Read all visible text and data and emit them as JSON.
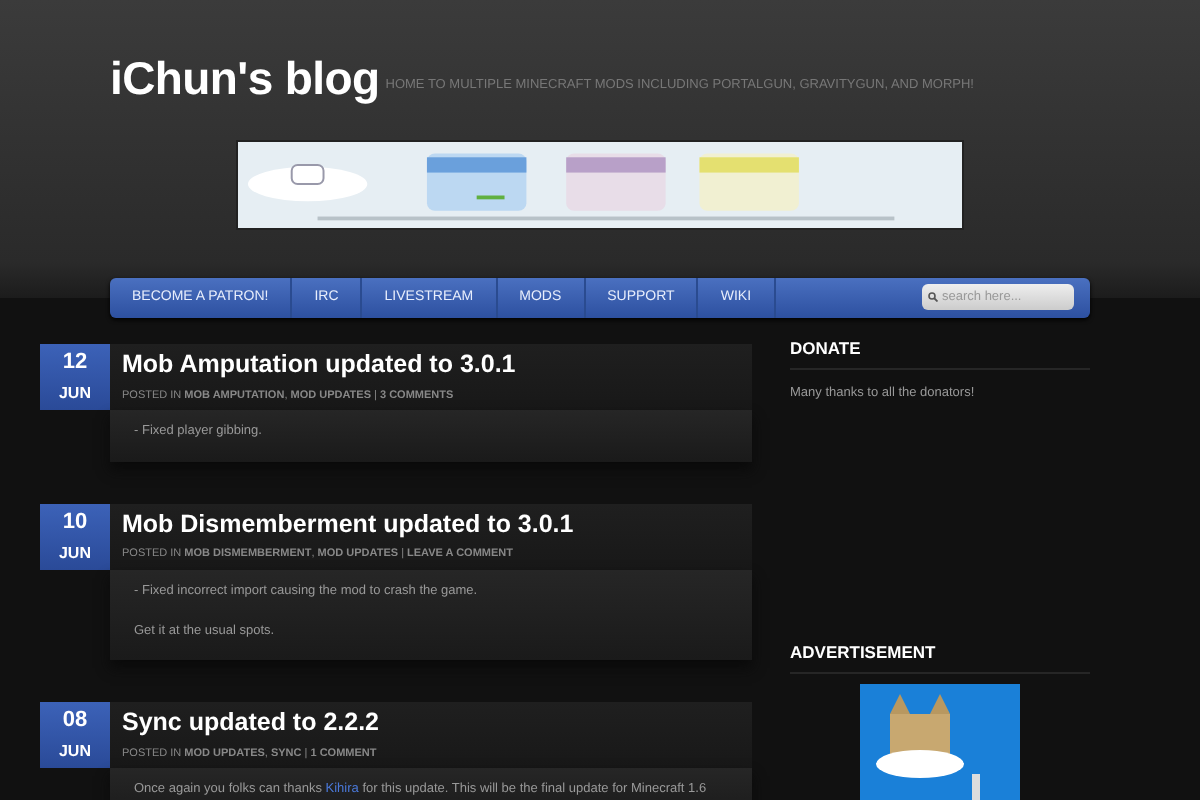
{
  "site": {
    "title": "iChun's blog",
    "tagline": "HOME TO MULTIPLE MINECRAFT MODS INCLUDING PORTALGUN, GRAVITYGUN, AND MORPH!"
  },
  "nav": {
    "items": [
      {
        "label": "BECOME A PATRON!"
      },
      {
        "label": "IRC"
      },
      {
        "label": "LIVESTREAM"
      },
      {
        "label": "MODS"
      },
      {
        "label": "SUPPORT"
      },
      {
        "label": "WIKI"
      }
    ],
    "search": {
      "placeholder": "search here..."
    }
  },
  "posts": [
    {
      "day": "12",
      "month": "JUN",
      "title": "Mob Amputation updated to 3.0.1",
      "posted_in": "POSTED IN",
      "categories": [
        "MOB AMPUTATION",
        "MOD UPDATES"
      ],
      "comments": "3 COMMENTS",
      "separators": [
        ",",
        "|"
      ],
      "body": [
        [
          {
            "kind": "text",
            "text": "- Fixed player gibbing."
          }
        ]
      ]
    },
    {
      "day": "10",
      "month": "JUN",
      "title": "Mob Dismemberment updated to 3.0.1",
      "posted_in": "POSTED IN",
      "categories": [
        "MOB DISMEMBERMENT",
        "MOD UPDATES"
      ],
      "comments": "LEAVE A COMMENT",
      "separators": [
        ",",
        "|"
      ],
      "body": [
        [
          {
            "kind": "text",
            "text": "- Fixed incorrect import causing the mod to crash the game."
          }
        ],
        [
          {
            "kind": "text",
            "text": "Get it at the usual spots."
          }
        ]
      ]
    },
    {
      "day": "08",
      "month": "JUN",
      "title": "Sync updated to 2.2.2",
      "posted_in": "POSTED IN",
      "categories": [
        "MOD UPDATES",
        "SYNC"
      ],
      "comments": "1 COMMENT",
      "separators": [
        ",",
        "|"
      ],
      "body": [
        [
          {
            "kind": "text",
            "text": "Once again you folks can thanks "
          },
          {
            "kind": "link",
            "text": "Kihira"
          },
          {
            "kind": "text",
            "text": " for this update. This will be the final update for Minecraft 1.6"
          }
        ]
      ]
    }
  ],
  "sidebar": [
    {
      "kind": "text",
      "heading": "DONATE",
      "text": "Many thanks to all the donators!"
    },
    {
      "kind": "picture",
      "heading": "ADVERTISEMENT"
    }
  ]
}
